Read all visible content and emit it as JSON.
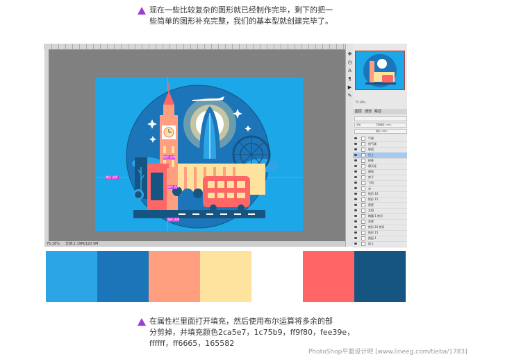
{
  "instructions": {
    "top_lines": [
      "现在一些比较复杂的图形就已经制作完毕，剩下的把一",
      "些简单的图形补充完整，我们的基本型就创建完毕了。"
    ],
    "bottom_lines": [
      "在属性栏里面打开填充，然后使用布尔运算将多余的部",
      "分剪掉，并填充颜色2ca5e7，1c75b9，ff9f80，fee39e，",
      "ffffff，ff6665，165582"
    ]
  },
  "photoshop": {
    "status_zoom": "75.28%",
    "status_doc": "文档:1.19M/120.9M",
    "nav_zoom": "75.28%",
    "panel_tabs": [
      "图层",
      "通道",
      "路径"
    ],
    "blend_mode": "正常",
    "opacity_label": "不透明度: 100%",
    "fill_label": "填充: 100%",
    "canvas_labels": [
      "路径 选择",
      "路径 选择",
      "路径 选择",
      "路径 选择"
    ],
    "layers": [
      {
        "name": "气球",
        "selected": false
      },
      {
        "name": "热气球",
        "selected": false
      },
      {
        "name": "钟塔",
        "selected": false
      },
      {
        "name": "巴士",
        "selected": true
      },
      {
        "name": "树林",
        "selected": false
      },
      {
        "name": "摩天轮",
        "selected": false
      },
      {
        "name": "建筑",
        "selected": false
      },
      {
        "name": "房子",
        "selected": false
      },
      {
        "name": "飞机",
        "selected": false
      },
      {
        "name": "云",
        "selected": false
      },
      {
        "name": "矩形 16",
        "selected": false
      },
      {
        "name": "矩形 15",
        "selected": false
      },
      {
        "name": "星星",
        "selected": false
      },
      {
        "name": "太阳",
        "selected": false
      },
      {
        "name": "椭圆 1 拷贝",
        "selected": false
      },
      {
        "name": "背景",
        "selected": false
      },
      {
        "name": "矩形 16 拷贝",
        "selected": false
      },
      {
        "name": "矩形 15",
        "selected": false
      },
      {
        "name": "图层 1",
        "selected": false
      },
      {
        "name": "组 1",
        "selected": false
      }
    ]
  },
  "palette": [
    "#2ca5e7",
    "#1c75b9",
    "#ff9f80",
    "#fee39e",
    "#ffffff",
    "#ff6665",
    "#165582"
  ],
  "watermark": "PhotoShop平面设计吧 [www.lineeg.com/tieba/1783]",
  "colors": {
    "accent": "#9b3fd0",
    "panel_select": "#a7c9f0"
  }
}
